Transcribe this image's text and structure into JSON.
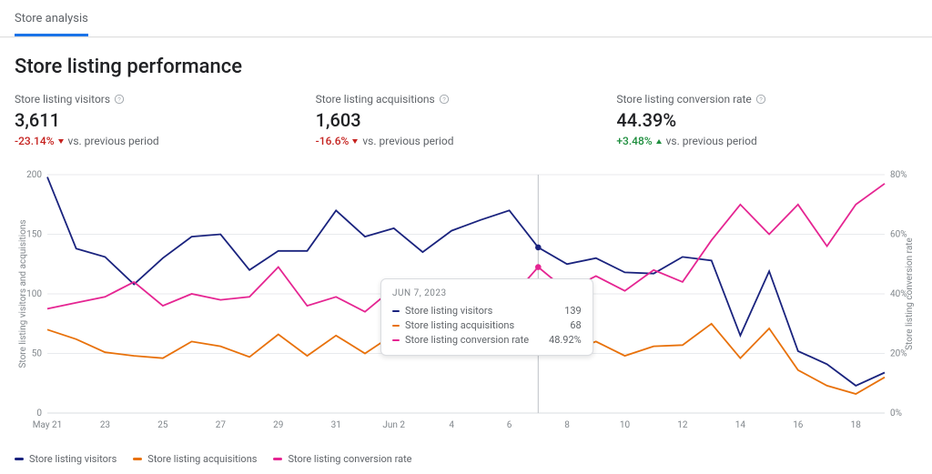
{
  "tab": {
    "active_label": "Store analysis"
  },
  "section_title": "Store listing performance",
  "kpis": [
    {
      "label": "Store listing visitors",
      "value": "3,611",
      "delta": "-23.14%",
      "direction": "down",
      "suffix": "vs. previous period"
    },
    {
      "label": "Store listing acquisitions",
      "value": "1,603",
      "delta": "-16.6%",
      "direction": "down",
      "suffix": "vs. previous period"
    },
    {
      "label": "Store listing conversion rate",
      "value": "44.39%",
      "delta": "+3.48%",
      "direction": "up",
      "suffix": "vs. previous period"
    }
  ],
  "legend": [
    {
      "name": "Store listing visitors",
      "color": "#1a237e"
    },
    {
      "name": "Store listing acquisitions",
      "color": "#e8710a"
    },
    {
      "name": "Store listing conversion rate",
      "color": "#e52592"
    }
  ],
  "tooltip": {
    "date": "JUN 7, 2023",
    "rows": [
      {
        "name": "Store listing visitors",
        "color": "#1a237e",
        "value": "139"
      },
      {
        "name": "Store listing acquisitions",
        "color": "#e8710a",
        "value": "68"
      },
      {
        "name": "Store listing conversion rate",
        "color": "#e52592",
        "value": "48.92%"
      }
    ]
  },
  "chart_data": {
    "type": "line",
    "title": "Store listing performance",
    "x": [
      "May 21",
      "May 22",
      "May 23",
      "May 24",
      "May 25",
      "May 26",
      "May 27",
      "May 28",
      "May 29",
      "May 30",
      "May 31",
      "Jun 1",
      "Jun 2",
      "Jun 3",
      "Jun 4",
      "Jun 5",
      "Jun 6",
      "Jun 7",
      "Jun 8",
      "Jun 9",
      "Jun 10",
      "Jun 11",
      "Jun 12",
      "Jun 13",
      "Jun 14",
      "Jun 15",
      "Jun 16",
      "Jun 17",
      "Jun 18",
      "Jun 19"
    ],
    "x_tick_labels": [
      "May 21",
      "23",
      "25",
      "27",
      "29",
      "31",
      "Jun 2",
      "4",
      "6",
      "8",
      "10",
      "12",
      "14",
      "16",
      "18"
    ],
    "left_axis": {
      "label": "Store listing visitors and acquisitions",
      "ticks": [
        0,
        50,
        100,
        150,
        200
      ],
      "range": [
        0,
        200
      ]
    },
    "right_axis": {
      "label": "Store listing conversion rate",
      "ticks_labels": [
        "0%",
        "20%",
        "40%",
        "60%",
        "80%"
      ],
      "ticks": [
        0,
        20,
        40,
        60,
        80
      ],
      "range": [
        0,
        80
      ]
    },
    "series": [
      {
        "name": "Store listing visitors",
        "color": "#1a237e",
        "axis": "left",
        "values": [
          198,
          138,
          131,
          108,
          130,
          148,
          150,
          120,
          136,
          136,
          170,
          148,
          155,
          135,
          153,
          162,
          170,
          139,
          125,
          130,
          118,
          117,
          131,
          128,
          65,
          119,
          52,
          41,
          23,
          34
        ]
      },
      {
        "name": "Store listing acquisitions",
        "color": "#e8710a",
        "axis": "left",
        "values": [
          70,
          62,
          51,
          48,
          46,
          60,
          56,
          47,
          66,
          48,
          65,
          50,
          66,
          55,
          62,
          61,
          65,
          68,
          51,
          60,
          48,
          56,
          57,
          75,
          46,
          71,
          36,
          23,
          16,
          30
        ]
      },
      {
        "name": "Store listing conversion rate",
        "color": "#e52592",
        "axis": "right",
        "values": [
          35,
          37,
          39,
          44,
          36,
          40,
          38,
          39,
          49,
          36,
          39,
          34,
          42,
          41,
          41,
          38,
          38,
          49,
          41,
          46,
          41,
          48,
          44,
          58,
          70,
          60,
          70,
          56,
          70,
          77
        ]
      }
    ],
    "hover_index": 17
  }
}
